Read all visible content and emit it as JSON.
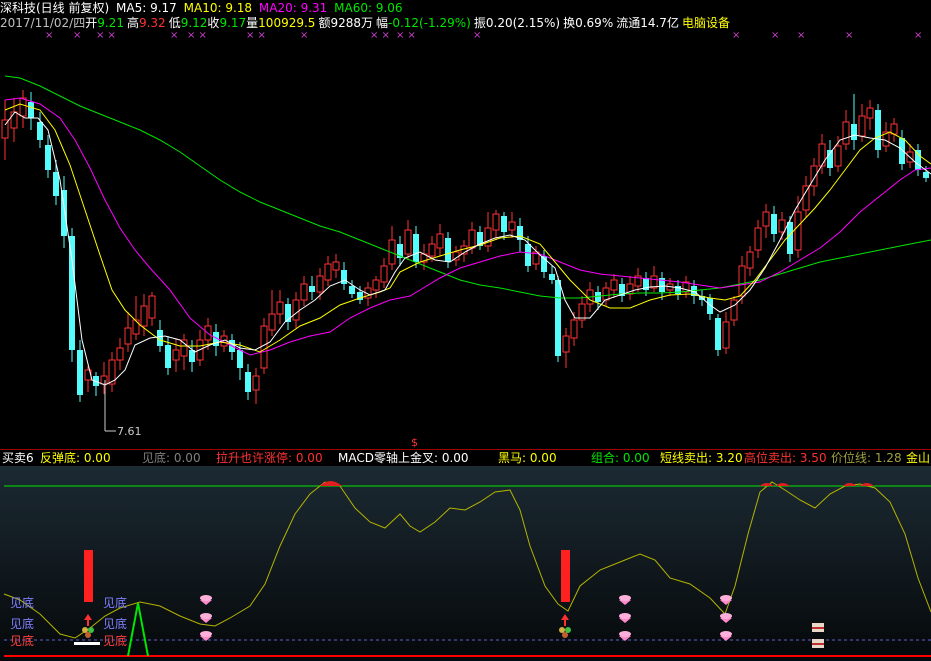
{
  "header": {
    "name": "深科技(日线 前复权)",
    "ma5": "MA5: 9.17",
    "ma10": "MA10: 9.18",
    "ma20": "MA20: 9.31",
    "ma60": "MA60: 9.06",
    "date": "2017/11/02/四",
    "open_label": "开",
    "open": "9.21",
    "high_label": "高",
    "high": "9.32",
    "low_label": "低",
    "low": "9.12",
    "close_label": "收",
    "close": "9.17",
    "vol_label": "量",
    "vol": "100929.5",
    "amount": "额9288万",
    "change_label": "幅",
    "change": "-0.12(-1.29%)",
    "amplitude": "振0.20(2.15%)",
    "turnover": "换0.69%",
    "float": "流通14.7亿",
    "sector": "电脑设备"
  },
  "chart": {
    "low_price_label": "7.61",
    "dollar_mark": "$"
  },
  "indicator": {
    "name": "买卖6",
    "fantandi": "反弹底: 0.00",
    "jiandi": "见底: 0.00",
    "lasheng": "拉升也许涨停: 0.00",
    "macd": "MACD零轴上金叉: 0.00",
    "heima": "黑马: 0.00",
    "zuhe": "组合: 0.00",
    "duanxian": "短线卖出: 3.20",
    "gaowei": "高位卖出: 3.50",
    "jiawei": "价位线: 1.28",
    "jinshan": "金山",
    "jd_label": "见底"
  },
  "colors": {
    "up": "#ff3232",
    "down": "#54fcfc",
    "ma5": "#ffffff",
    "ma10": "#ffff00",
    "ma20": "#ff00ff",
    "ma60": "#00e600",
    "indicator_line": "#b4b400"
  }
}
